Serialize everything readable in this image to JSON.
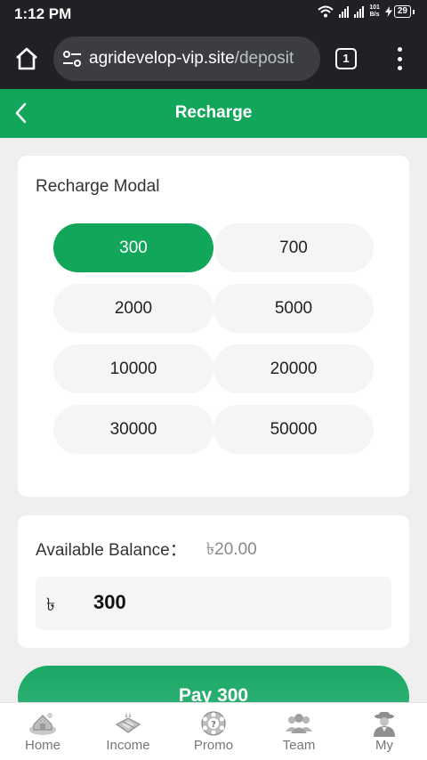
{
  "status_bar": {
    "time": "1:12 PM",
    "net_speed_value": "101",
    "net_speed_unit": "B/s",
    "battery": "29"
  },
  "browser": {
    "url_domain": "agridevelop-vip.site",
    "url_path": "/deposit",
    "tab_count": "1"
  },
  "header": {
    "title": "Recharge"
  },
  "recharge_modal": {
    "label": "Recharge Modal",
    "selected": "300",
    "amounts": [
      "300",
      "700",
      "2000",
      "5000",
      "10000",
      "20000",
      "30000",
      "50000"
    ]
  },
  "balance": {
    "label": "Available Balance：",
    "value": "৳20.00",
    "currency_symbol": "৳",
    "input_value": "300"
  },
  "pay_button": {
    "label": "Pay 300"
  },
  "nav": {
    "items": [
      {
        "label": "Home",
        "icon": "home-icon"
      },
      {
        "label": "Income",
        "icon": "income-icon"
      },
      {
        "label": "Promo",
        "icon": "promo-icon"
      },
      {
        "label": "Team",
        "icon": "team-icon"
      },
      {
        "label": "My",
        "icon": "profile-icon"
      }
    ]
  },
  "colors": {
    "accent": "#12a65b",
    "browser_chrome": "#202124"
  }
}
